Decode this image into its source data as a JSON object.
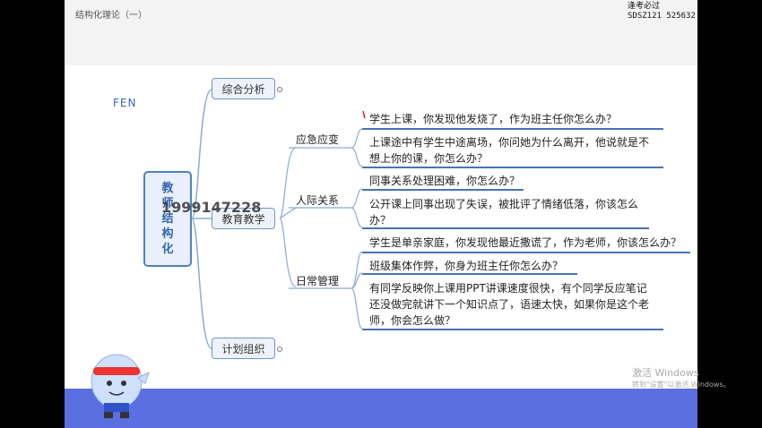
{
  "header": {
    "title": "结构化理论（一）"
  },
  "watermark": {
    "line1": "逢考必过",
    "line2": "SDSZ121 525632",
    "fen": "FEN",
    "phone": "1999147228"
  },
  "mindmap": {
    "root": "教师结构化",
    "branches": [
      {
        "label": "综合分析"
      },
      {
        "label": "教育教学"
      },
      {
        "label": "计划组织"
      }
    ],
    "sub": [
      {
        "label": "应急应变"
      },
      {
        "label": "人际关系"
      },
      {
        "label": "日常管理"
      }
    ],
    "items": {
      "a1": "学生上课，你发现他发烧了，作为班主任你怎么办？",
      "a2l1": "上课途中有学生中途离场，你问她为什么离开，他说就是不",
      "a2l2": "想上你的课，你怎么办？",
      "b1": "同事关系处理困难，你怎么办？",
      "b2l1": "公开课上同事出现了失误，被批评了情绪低落，你该怎么",
      "b2l2": "办？",
      "c1": "学生是单亲家庭，你发现他最近撒谎了，作为老师，你该怎么办？",
      "c2": "班级集体作弊，你身为班主任你怎么办？",
      "c3l1": "有同学反映你上课用PPT讲课速度很快，有个同学反应笔记",
      "c3l2": "还没做完就讲下一个知识点了，语速太快，如果你是这个老",
      "c3l3": "师，你会怎么做？"
    }
  },
  "activation": {
    "line1": "激活 Windows",
    "line2": "转到\"设置\"以激活 Windows。"
  },
  "colors": {
    "accent": "#4a72b4",
    "band": "#5a6fe0"
  },
  "icons": {
    "mascot": "mascot-icon"
  }
}
